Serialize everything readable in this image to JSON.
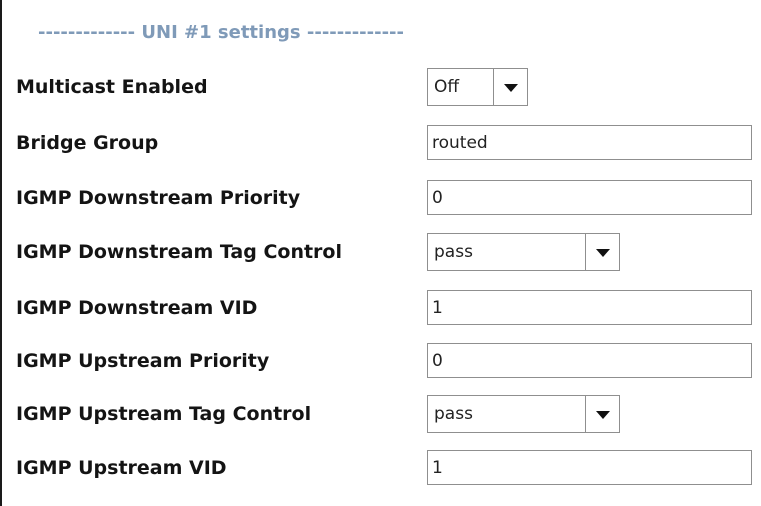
{
  "section": {
    "title": "------------- UNI #1 settings -------------"
  },
  "fields": {
    "multicast_enabled": {
      "label": "Multicast Enabled",
      "value": "Off"
    },
    "bridge_group": {
      "label": "Bridge Group",
      "value": "routed"
    },
    "igmp_downstream_priority": {
      "label": "IGMP Downstream Priority",
      "value": "0"
    },
    "igmp_downstream_tag_control": {
      "label": "IGMP Downstream Tag Control",
      "value": "pass"
    },
    "igmp_downstream_vid": {
      "label": "IGMP Downstream VID",
      "value": "1"
    },
    "igmp_upstream_priority": {
      "label": "IGMP Upstream Priority",
      "value": "0"
    },
    "igmp_upstream_tag_control": {
      "label": "IGMP Upstream Tag Control",
      "value": "pass"
    },
    "igmp_upstream_vid": {
      "label": "IGMP Upstream VID",
      "value": "1"
    }
  }
}
